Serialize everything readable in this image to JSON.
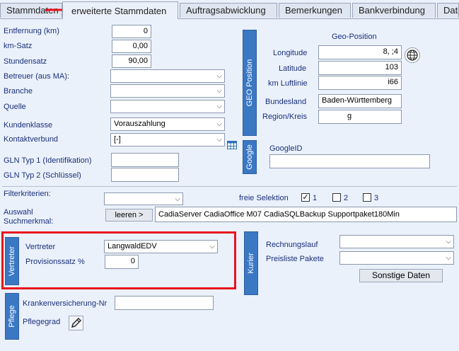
{
  "tabs": [
    "Stammdaten",
    "erweiterte Stammdaten",
    "Auftragsabwicklung",
    "Bemerkungen",
    "Bankverbindung",
    "Date"
  ],
  "form": {
    "entfernung": {
      "label": "Entfernung (km)",
      "value": "0"
    },
    "kmsatz": {
      "label": "km-Satz",
      "value": "0,00"
    },
    "stundensatz": {
      "label": "Stundensatz",
      "value": "90,00"
    },
    "betreuer": {
      "label": "Betreuer (aus MA):",
      "value": ""
    },
    "branche": {
      "label": "Branche",
      "value": ""
    },
    "quelle": {
      "label": "Quelle",
      "value": ""
    },
    "kundenklasse": {
      "label": "Kundenklasse",
      "value": "Vorauszahlung"
    },
    "kontaktverbund": {
      "label": "Kontaktverbund",
      "value": "[-]"
    },
    "gln1": {
      "label": "GLN Typ 1 (Identifikation)",
      "value": ""
    },
    "gln2": {
      "label": "GLN Typ 2 (Schlüssel)",
      "value": ""
    }
  },
  "geo": {
    "bar": "GEO Position",
    "title": "Geo-Position",
    "longitude": {
      "label": "Longitude",
      "value": "8,      ;4"
    },
    "latitude": {
      "label": "Latitude",
      "value": "103"
    },
    "luftlinie": {
      "label": "km Luftlinie",
      "value": "i66"
    },
    "bundesland": {
      "label": "Bundesland",
      "value": "Baden-Württemberg"
    },
    "region": {
      "label": "Region/Kreis",
      "value": "g"
    }
  },
  "google": {
    "bar": "Google",
    "label": "GoogleID",
    "value": ""
  },
  "filter": {
    "label": "Filterkriterien:",
    "value": "",
    "freie_label": "freie Selektion",
    "check1": "1",
    "check1_state": "✓",
    "check2": "2",
    "check3": "3"
  },
  "auswahl": {
    "label_line1": "Auswahl",
    "label_line2": "Suchmerkmal:",
    "leeren": "leeren >",
    "value": "CadiaServer CadiaOffice M07 CadiaSQLBackup Supportpaket180Min"
  },
  "vertreter": {
    "bar": "Vertreter",
    "label": "Vertreter",
    "value": "LangwaldEDV",
    "prov_label": "Provisionssatz %",
    "prov_value": "0"
  },
  "kurier": {
    "bar": "Kurier",
    "rechnungslauf": "Rechnungslauf",
    "rechnungslauf_value": "",
    "preisliste": "Preisliste Pakete",
    "preisliste_value": "",
    "sonstige": "Sonstige Daten"
  },
  "pflege": {
    "bar": "Pflege",
    "kv_label": "Krankenversicherung-Nr",
    "kv_value": "",
    "grad_label": "Pflegegrad"
  },
  "colors": {
    "accent": "#3b78c4",
    "highlight": "#e8121d"
  }
}
